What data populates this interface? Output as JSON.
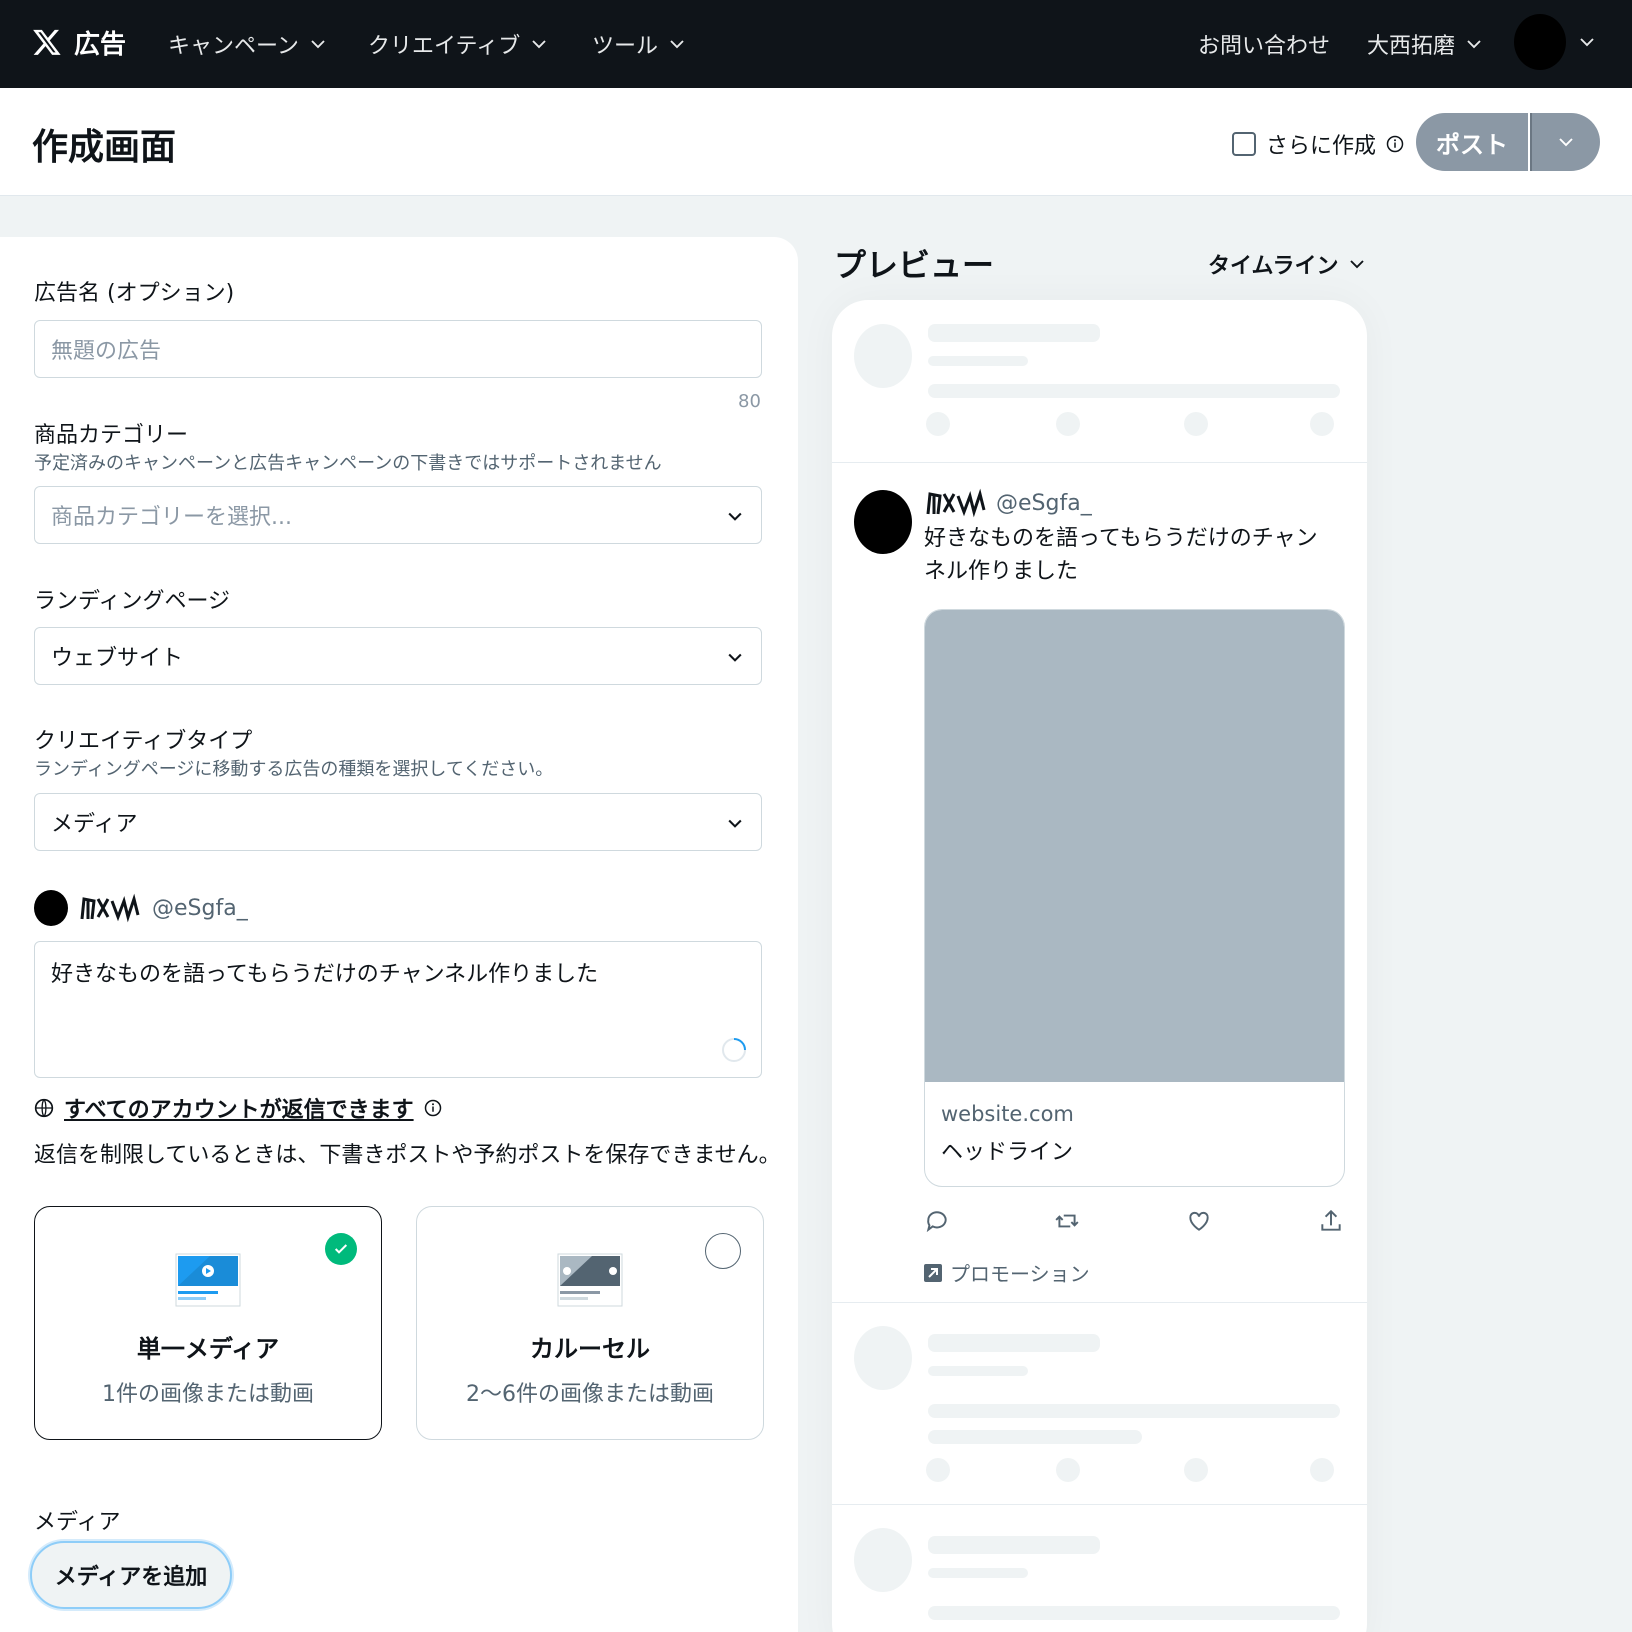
{
  "topnav": {
    "brand": "広告",
    "menu": [
      {
        "label": "キャンペーン"
      },
      {
        "label": "クリエイティブ"
      },
      {
        "label": "ツール"
      }
    ],
    "contact": "お問い合わせ",
    "user_name": "大西拓磨"
  },
  "header": {
    "title": "作成画面",
    "create_more_label": "さらに作成",
    "post_label": "ポスト"
  },
  "form": {
    "ad_name_label": "広告名 (オプション)",
    "ad_name_placeholder": "無題の広告",
    "ad_name_counter": "80",
    "category_label": "商品カテゴリー",
    "category_note": "予定済みのキャンペーンと広告キャンペーンの下書きではサポートされません",
    "category_placeholder": "商品カテゴリーを選択...",
    "landing_label": "ランディングページ",
    "landing_value": "ウェブサイト",
    "creative_type_label": "クリエイティブタイプ",
    "creative_type_note": "ランディングページに移動する広告の種類を選択してください。",
    "creative_type_value": "メディア",
    "account_handle": "@eSgfa_",
    "post_text": "好きなものを語ってもらうだけのチャンネル作りました",
    "reply_setting": "すべてのアカウントが返信できます",
    "reply_note": "返信を制限しているときは、下書きポストや予約ポストを保存できません。",
    "single_media_title": "単一メディア",
    "single_media_desc": "1件の画像または動画",
    "carousel_title": "カルーセル",
    "carousel_desc": "2〜6件の画像または動画",
    "media_label": "メディア",
    "add_media_label": "メディアを追加"
  },
  "preview": {
    "title": "プレビュー",
    "placement": "タイムライン",
    "tweet": {
      "handle": "@eSgfa_",
      "text": "好きなものを語ってもらうだけのチャンネル作りました",
      "domain": "website.com",
      "headline": "ヘッドライン",
      "promoted": "プロモーション"
    }
  },
  "colors": {
    "nav_bg": "#0f1419",
    "accent_success": "#00ba7c",
    "media_placeholder": "#aab8c2",
    "button_disabled": "#8b98a5"
  },
  "icons": [
    "x-logo-icon",
    "chevron-down-icon",
    "info-icon",
    "spinner-icon",
    "globe-icon",
    "check-icon",
    "reply-icon",
    "repost-icon",
    "like-icon",
    "share-icon",
    "promoted-icon"
  ]
}
